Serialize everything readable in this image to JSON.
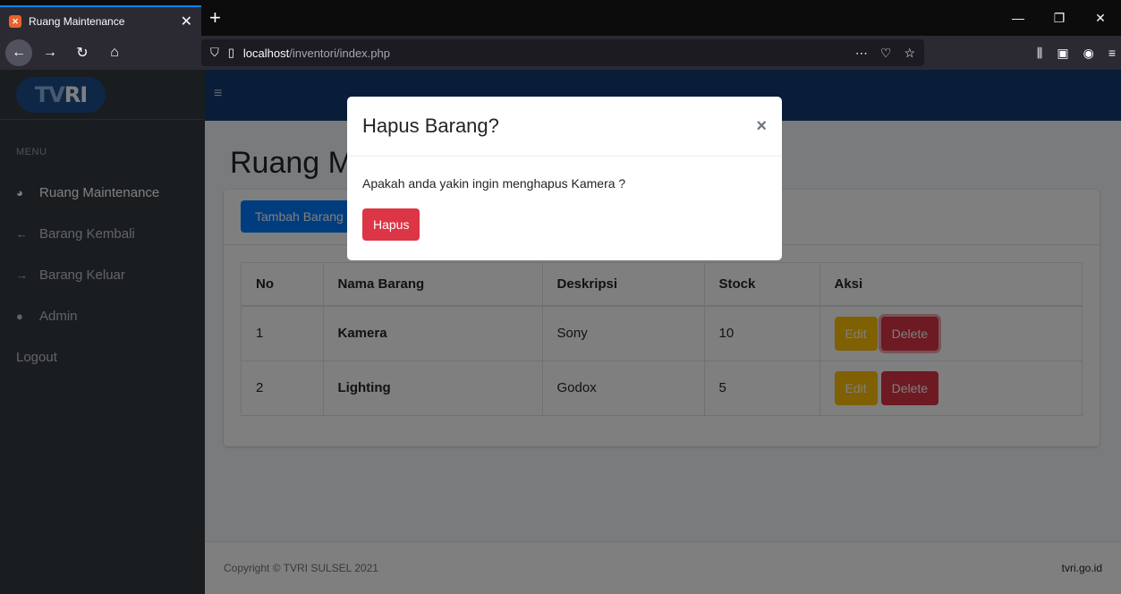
{
  "browser": {
    "tab_title": "Ruang Maintenance",
    "tab_close": "✕",
    "new_tab": "+",
    "url_host": "localhost",
    "url_path": "/inventori/index.php",
    "icons": [
      "shield-icon",
      "page-icon",
      "more-icon",
      "pocket-icon",
      "star-icon",
      "library-icon",
      "sidebar-icon",
      "account-icon",
      "menu-icon"
    ]
  },
  "app": {
    "brand_tv": "TV",
    "brand_ri": "RI",
    "sidebar": {
      "header": "MENU",
      "items": [
        {
          "label": "Ruang Maintenance",
          "icon": "tachometer-icon"
        },
        {
          "label": "Barang Kembali",
          "icon": "arrow-left-icon"
        },
        {
          "label": "Barang Keluar",
          "icon": "arrow-right-icon"
        },
        {
          "label": "Admin",
          "icon": "user-icon"
        },
        {
          "label": "Logout",
          "icon": ""
        }
      ]
    },
    "page_title": "Ruang Maintenance",
    "add_button": "Tambah Barang",
    "table": {
      "headers": [
        "No",
        "Nama Barang",
        "Deskripsi",
        "Stock",
        "Aksi"
      ],
      "rows": [
        {
          "no": "1",
          "name": "Kamera",
          "desc": "Sony",
          "stock": "10"
        },
        {
          "no": "2",
          "name": "Lighting",
          "desc": "Godox",
          "stock": "5"
        }
      ],
      "edit_label": "Edit",
      "delete_label": "Delete"
    },
    "footer": {
      "copyright": "Copyright © TVRI SULSEL 2021",
      "site": "tvri.go.id"
    }
  },
  "modal": {
    "title": "Hapus Barang?",
    "close": "×",
    "message": "Apakah anda yakin ingin menghapus Kamera ?",
    "confirm_label": "Hapus"
  },
  "colors": {
    "primary": "#007bff",
    "danger": "#dc3545",
    "warning": "#ffc107",
    "sidebar": "#343a40",
    "topnav": "#123b70"
  }
}
